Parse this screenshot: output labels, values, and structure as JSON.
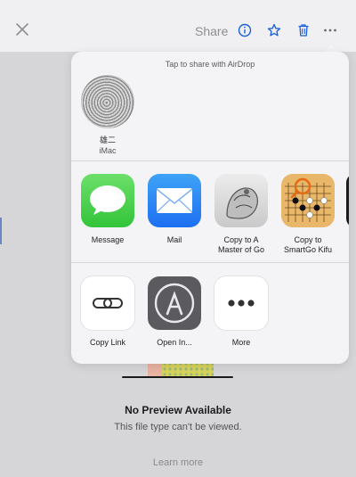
{
  "header": {
    "title": "Share",
    "icons": [
      "close-icon",
      "info-icon",
      "star-icon",
      "trash-icon",
      "more-icon"
    ]
  },
  "share_sheet": {
    "airdrop_hint": "Tap to share with AirDrop",
    "devices": [
      {
        "name": "雄二",
        "model": "iMac"
      }
    ],
    "apps": [
      {
        "label": "Message"
      },
      {
        "label": "Mail"
      },
      {
        "label": "Copy to A Master of Go"
      },
      {
        "label": "Copy to SmartGo Kifu"
      }
    ],
    "actions": [
      {
        "label": "Copy Link"
      },
      {
        "label": "Open In..."
      },
      {
        "label": "More"
      }
    ]
  },
  "preview": {
    "title": "No Preview Available",
    "subtitle": "This file type can't be viewed.",
    "learn_more": "Learn more"
  },
  "colors": {
    "accent": "#1a5fd8",
    "message_green": "#4cd964",
    "mail_blue": "#1d6ff0"
  }
}
